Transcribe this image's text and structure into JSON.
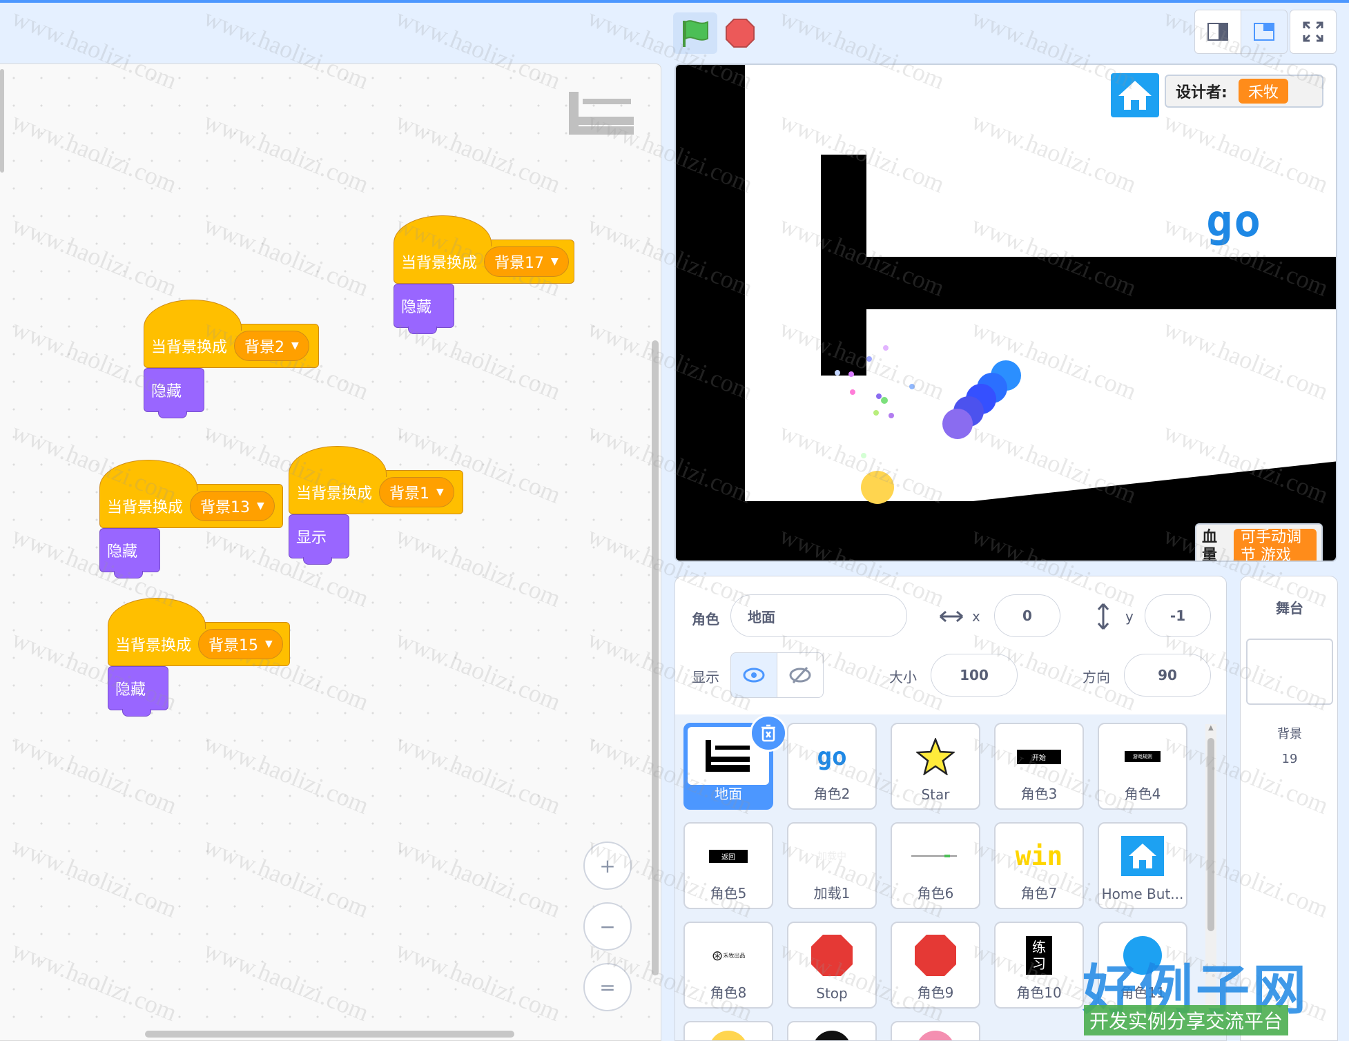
{
  "toolbar": {
    "green_flag": "green-flag-icon",
    "stop": "stop-sign-icon"
  },
  "script_blocks": [
    {
      "hat_label": "当背景换成",
      "backdrop": "背景17",
      "action": "隐藏"
    },
    {
      "hat_label": "当背景换成",
      "backdrop": "背景2",
      "action": "隐藏"
    },
    {
      "hat_label": "当背景换成",
      "backdrop": "背景13",
      "action": "隐藏"
    },
    {
      "hat_label": "当背景换成",
      "backdrop": "背景1",
      "action": "显示"
    },
    {
      "hat_label": "当背景换成",
      "backdrop": "背景15",
      "action": "隐藏"
    }
  ],
  "zoom": {
    "in": "+",
    "out": "−",
    "reset": "="
  },
  "stage": {
    "designer_label": "设计者:",
    "designer_name": "禾牧",
    "go_text": "go",
    "hp_label": "血量",
    "adjust_label": "可手动调节 游戏"
  },
  "sprite_info": {
    "sprite_label": "角色",
    "sprite_name": "地面",
    "x_label": "x",
    "x_value": "0",
    "y_label": "y",
    "y_value": "-1",
    "show_label": "显示",
    "size_label": "大小",
    "size_value": "100",
    "direction_label": "方向",
    "direction_value": "90"
  },
  "sprites": [
    "地面",
    "角色2",
    "Star",
    "角色3",
    "角色4",
    "角色5",
    "加载1",
    "角色6",
    "角色7",
    "Home But...",
    "角色8",
    "Stop",
    "角色9",
    "角色10",
    "角色11"
  ],
  "sprite_thumb_text": {
    "t3": "开始",
    "t4": "游戏规则",
    "t5": "返回",
    "t6": "加载中",
    "t7": "win",
    "t8": "禾牧出品",
    "t10": "练习"
  },
  "stage_panel": {
    "title": "舞台",
    "backdrops_label": "背景",
    "backdrops_count": "19"
  },
  "watermark": {
    "text": "www.haolizi.com",
    "logo": "好例子网",
    "slogan": "开发实例分享交流平台"
  },
  "colors": {
    "events": "#ffbf00",
    "looks": "#9966ff",
    "accent": "#4c97ff",
    "designer_badge": "#ff8c1a"
  }
}
